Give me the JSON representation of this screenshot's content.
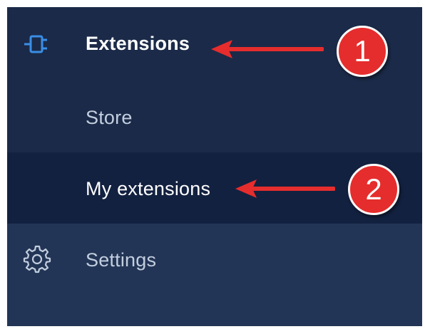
{
  "sidebar": {
    "items": [
      {
        "label": "Extensions",
        "icon": "plug-icon",
        "active": true
      },
      {
        "label": "Store"
      },
      {
        "label": "My extensions",
        "selected": true
      },
      {
        "label": "Settings",
        "icon": "gear-icon"
      }
    ]
  },
  "annotations": {
    "step1": "1",
    "step2": "2"
  },
  "colors": {
    "sidebar_bg": "#1b2a48",
    "selected_bg": "#132140",
    "settings_bg": "#233556",
    "accent_blue": "#3a8ee6",
    "annotation_red": "#e52d2d"
  }
}
